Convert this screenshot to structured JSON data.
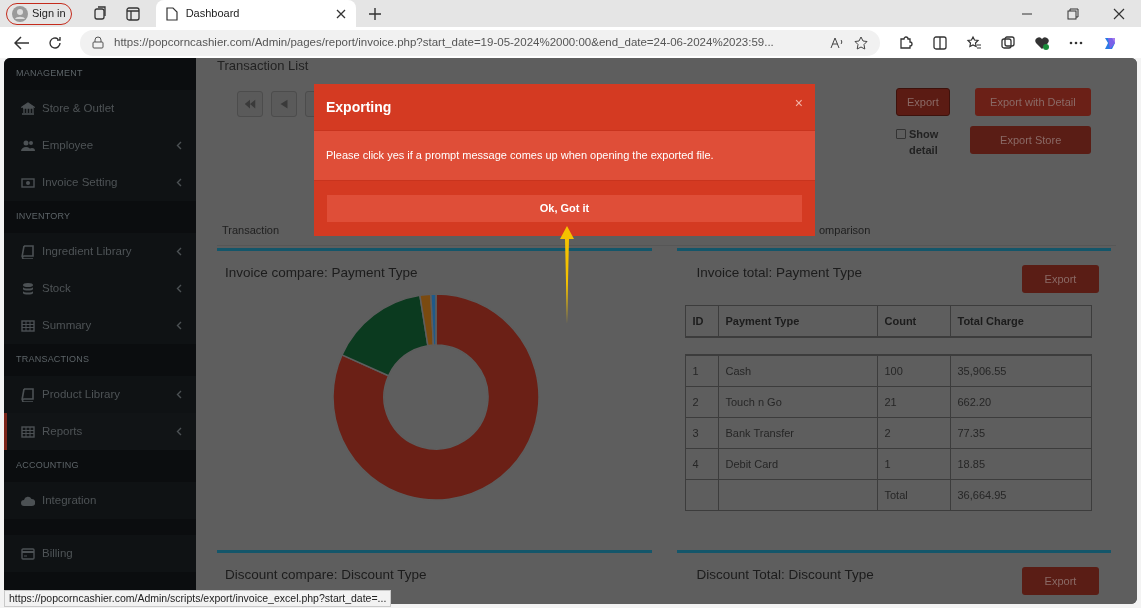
{
  "browser": {
    "sign_in": "Sign in",
    "tab_title": "Dashboard",
    "url": "https://popcorncashier.com/Admin/pages/report/invoice.php?start_date=19-05-2024%2000:00&end_date=24-06-2024%2023:59...",
    "status_url": "https://popcorncashier.com/Admin/scripts/export/invoice_excel.php?start_date=..."
  },
  "sidebar": [
    {
      "kind": "header",
      "label": "MANAGEMENT"
    },
    {
      "kind": "item",
      "label": "Store & Outlet",
      "caret": false,
      "selected": false
    },
    {
      "kind": "item",
      "label": "Employee",
      "caret": true,
      "selected": false
    },
    {
      "kind": "item",
      "label": "Invoice Setting",
      "caret": true,
      "selected": false
    },
    {
      "kind": "header",
      "label": "INVENTORY"
    },
    {
      "kind": "item",
      "label": "Ingredient Library",
      "caret": true,
      "selected": false
    },
    {
      "kind": "item",
      "label": "Stock",
      "caret": true,
      "selected": false
    },
    {
      "kind": "item",
      "label": "Summary",
      "caret": true,
      "selected": false
    },
    {
      "kind": "header",
      "label": "TRANSACTIONS"
    },
    {
      "kind": "item",
      "label": "Product Library",
      "caret": true,
      "selected": false
    },
    {
      "kind": "item",
      "label": "Reports",
      "caret": true,
      "selected": true
    },
    {
      "kind": "header",
      "label": "ACCOUNTING"
    },
    {
      "kind": "item",
      "label": "Integration",
      "caret": false,
      "selected": false
    },
    {
      "kind": "spacer"
    },
    {
      "kind": "item",
      "label": "Billing",
      "caret": false,
      "selected": false
    }
  ],
  "page": {
    "title": "Transaction List",
    "buttons": [
      "Export",
      "Export with Detail",
      "Export Store"
    ],
    "show_detail": {
      "label": "Show detail",
      "checked": false
    },
    "tabs": [
      {
        "label": "Transaction",
        "selected": false
      },
      {
        "label": "omparison",
        "selected": false
      }
    ]
  },
  "cards": [
    {
      "title": "Invoice compare: Payment Type"
    },
    {
      "title": "Invoice total: Payment Type",
      "export": "Export",
      "table": {
        "columns": [
          "ID",
          "Payment Type",
          "Count",
          "Total Charge"
        ],
        "rows": [
          [
            "1",
            "Cash",
            "100",
            "35,906.55"
          ],
          [
            "2",
            "Touch n Go",
            "21",
            "662.20"
          ],
          [
            "3",
            "Bank Transfer",
            "2",
            "77.35"
          ],
          [
            "4",
            "Debit Card",
            "1",
            "18.85"
          ],
          [
            "",
            "",
            "Total",
            "36,664.95"
          ]
        ]
      }
    },
    {
      "title": "Discount compare: Discount Type"
    },
    {
      "title": "Discount Total: Discount Type",
      "export": "Export"
    }
  ],
  "modal": {
    "title": "Exporting",
    "close": "×",
    "message": "Please click yes if a prompt message comes up when opening the exported file.",
    "button": "Ok, Got it"
  }
}
